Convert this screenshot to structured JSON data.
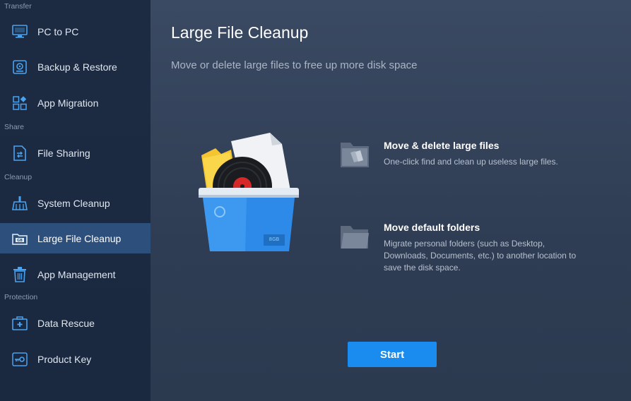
{
  "sidebar": {
    "sections": {
      "transfer": "Transfer",
      "share": "Share",
      "cleanup": "Cleanup",
      "protection": "Protection"
    },
    "items": [
      {
        "label": "PC to PC",
        "icon": "monitor-icon"
      },
      {
        "label": "Backup & Restore",
        "icon": "backup-icon"
      },
      {
        "label": "App Migration",
        "icon": "apps-grid-icon"
      },
      {
        "label": "File Sharing",
        "icon": "file-share-icon"
      },
      {
        "label": "System Cleanup",
        "icon": "broom-icon"
      },
      {
        "label": "Large File Cleanup",
        "icon": "gb-drive-icon",
        "active": true
      },
      {
        "label": "App Management",
        "icon": "trash-icon"
      },
      {
        "label": "Data Rescue",
        "icon": "rescue-box-icon"
      },
      {
        "label": "Product Key",
        "icon": "key-icon"
      }
    ]
  },
  "main": {
    "title": "Large File Cleanup",
    "subtitle": "Move or delete large files to free up more disk space",
    "features": [
      {
        "title": "Move & delete large files",
        "description": "One-click find and clean up useless large files.",
        "icon": "folder-files-icon"
      },
      {
        "title": "Move default folders",
        "description": "Migrate personal folders (such as Desktop, Downloads, Documents, etc.) to another location to save the disk space.",
        "icon": "open-folder-icon"
      }
    ],
    "start_label": "Start",
    "illustration": {
      "badge_text": "8GB"
    }
  },
  "colors": {
    "accent": "#1a8cf0",
    "sidebar_bg": "#1d2b42",
    "active_item_bg": "#2c4f7c",
    "main_bg": "#34445c"
  }
}
